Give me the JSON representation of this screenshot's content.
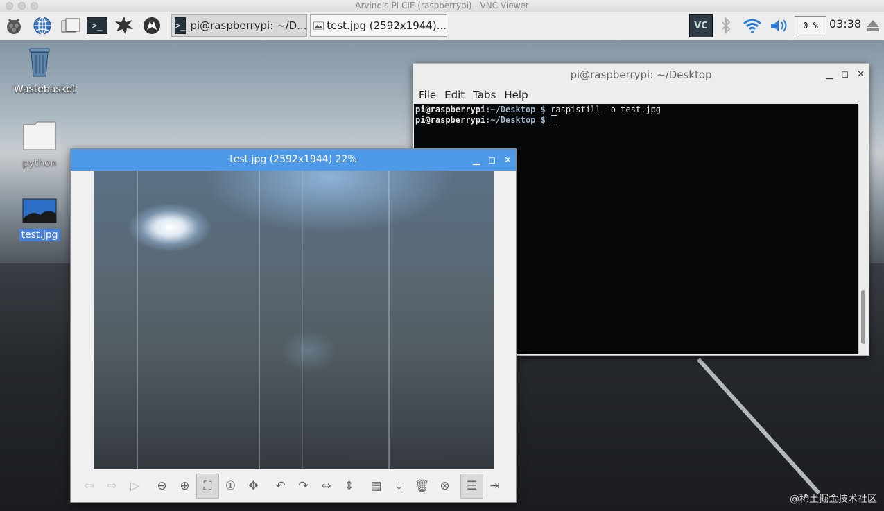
{
  "vnc": {
    "title": "Arvind's PI CIE (raspberrypi) - VNC Viewer"
  },
  "taskbar": {
    "tasks": [
      {
        "label": "pi@raspberrypi: ~/D..."
      },
      {
        "label": "test.jpg (2592x1944)..."
      }
    ],
    "tray": {
      "vnc_label": "VC",
      "cpu": "0 %",
      "clock": "03:38"
    }
  },
  "desktop": {
    "icons": [
      {
        "label": "Wastebasket"
      },
      {
        "label": "python"
      },
      {
        "label": "test.jpg"
      }
    ]
  },
  "terminal": {
    "title": "pi@raspberrypi: ~/Desktop",
    "menu": [
      "File",
      "Edit",
      "Tabs",
      "Help"
    ],
    "prompt_user": "pi@raspberrypi",
    "prompt_path": ":~/Desktop $",
    "lines": [
      {
        "command": "raspistill -o test.jpg"
      },
      {
        "command": ""
      }
    ]
  },
  "viewer": {
    "title": "test.jpg (2592x1944) 22%"
  },
  "watermark": "@稀土掘金技术社区",
  "colors": {
    "titlebar_active": "#4e9ae8",
    "terminal_bg": "#060708",
    "selection": "#4a7fd6"
  }
}
